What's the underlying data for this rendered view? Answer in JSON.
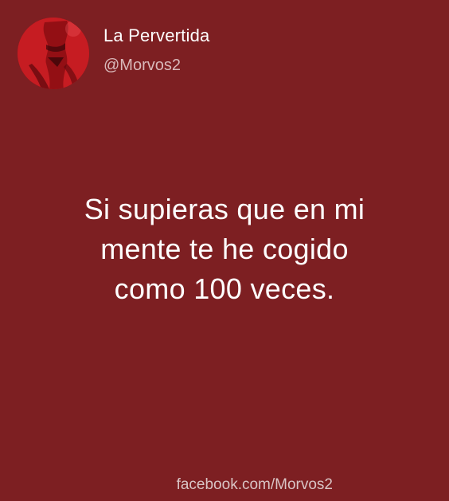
{
  "profile": {
    "display_name": "La Pervertida",
    "handle": "@Morvos2",
    "avatar_description": "profile-photo"
  },
  "post": {
    "lines": [
      "Si supieras que en mi",
      "mente te he cogido",
      "como 100 veces."
    ]
  },
  "footer": {
    "source": "facebook.com/Morvos2"
  },
  "colors": {
    "background": "#7d1f22",
    "text": "#ffffff",
    "handle": "#d9b9ba",
    "avatar": "#b0131b"
  }
}
